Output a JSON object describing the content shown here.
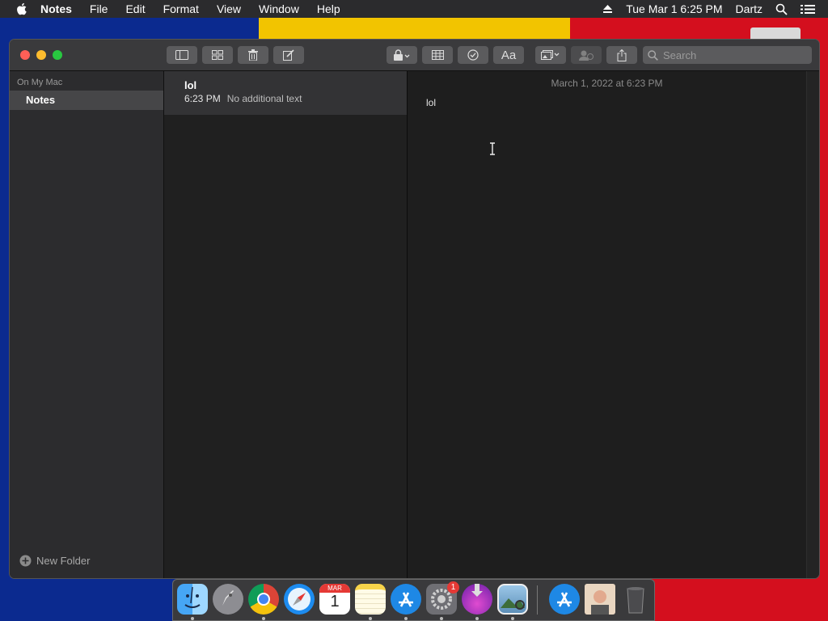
{
  "menubar": {
    "app_name": "Notes",
    "items": [
      "File",
      "Edit",
      "Format",
      "View",
      "Window",
      "Help"
    ],
    "clock": "Tue Mar 1  6:25 PM",
    "user": "Dartz"
  },
  "toolbar": {
    "search_placeholder": "Search",
    "font_button_label": "Aa"
  },
  "sidebar": {
    "section_label": "On My Mac",
    "selected_folder": "Notes",
    "new_folder_label": "New Folder"
  },
  "note_list": {
    "items": [
      {
        "title": "lol",
        "time": "6:23 PM",
        "preview": "No additional text"
      }
    ]
  },
  "editor": {
    "date": "March 1, 2022 at 6:23 PM",
    "body": "lol"
  },
  "dock": {
    "apps": [
      "Finder",
      "Launchpad",
      "Chrome",
      "Safari",
      "Calendar",
      "Notes",
      "App Store",
      "System Preferences",
      "Installer",
      "Preview",
      "App Store",
      "Contact",
      "Trash"
    ],
    "calendar_month": "MAR",
    "calendar_day": "1",
    "system_prefs_badge": "1"
  },
  "colors": {
    "wall_blue": "#0b2a8f",
    "wall_yellow": "#f2c400",
    "wall_red": "#d40f1e",
    "close": "#ff5f57",
    "minimize": "#febc2e",
    "zoom": "#28c840"
  }
}
